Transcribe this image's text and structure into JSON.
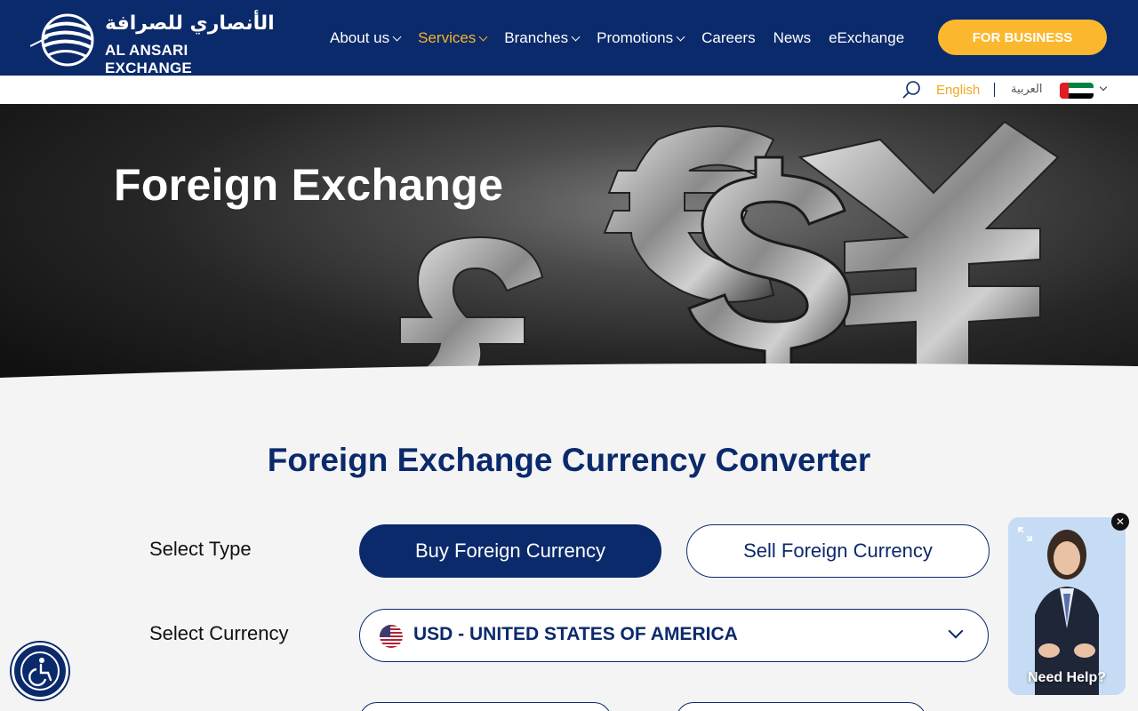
{
  "brand": {
    "name_ar": "الأنصاري للصرافة",
    "name_en": "AL ANSARI EXCHANGE"
  },
  "nav": {
    "items": [
      {
        "label": "About us",
        "dropdown": true,
        "active": false
      },
      {
        "label": "Services",
        "dropdown": true,
        "active": true
      },
      {
        "label": "Branches",
        "dropdown": true,
        "active": false
      },
      {
        "label": "Promotions",
        "dropdown": true,
        "active": false
      },
      {
        "label": "Careers",
        "dropdown": false,
        "active": false
      },
      {
        "label": "News",
        "dropdown": false,
        "active": false
      },
      {
        "label": "eExchange",
        "dropdown": false,
        "active": false
      }
    ],
    "business_button": "FOR BUSINESS"
  },
  "utility": {
    "lang_en": "English",
    "lang_ar": "العربية",
    "region_flag": "uae-flag-icon"
  },
  "hero": {
    "title": "Foreign Exchange"
  },
  "converter": {
    "title": "Foreign Exchange Currency Converter",
    "select_type_label": "Select Type",
    "buy_label": "Buy Foreign Currency",
    "sell_label": "Sell Foreign Currency",
    "selected_type": "buy",
    "select_currency_label": "Select Currency",
    "currency_value": "USD - UNITED STATES OF AMERICA",
    "currency_flag": "us-flag-icon"
  },
  "help_widget": {
    "label": "Need Help?"
  },
  "colors": {
    "brand_navy": "#0b2a6b",
    "accent_gold": "#fbb82f",
    "active_nav": "#f7b52a"
  }
}
